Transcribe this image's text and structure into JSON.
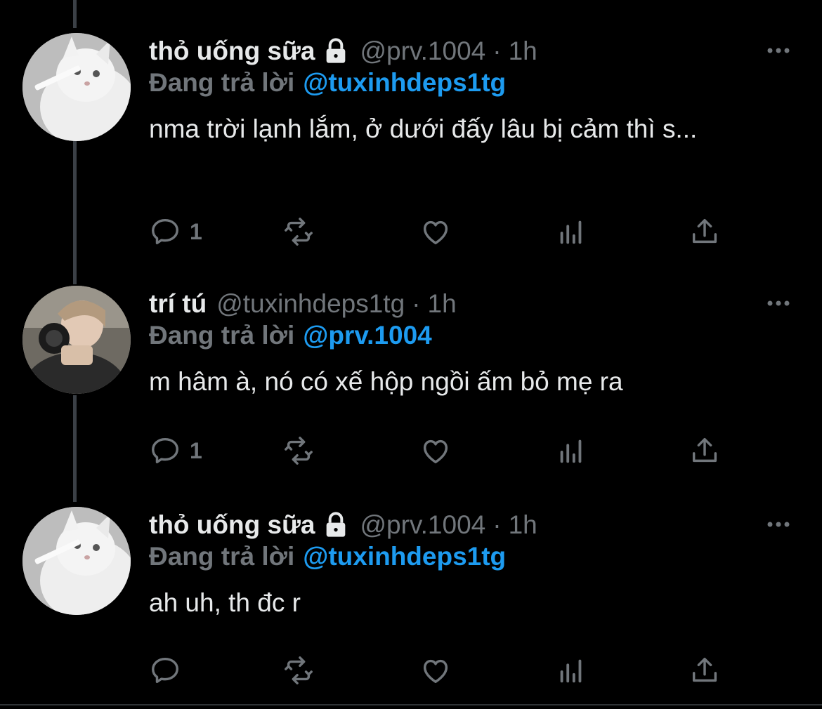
{
  "colors": {
    "background": "#000000",
    "text_primary": "#e7e9ea",
    "text_secondary": "#71767b",
    "accent": "#1d9bf0",
    "thread_line": "#3b4046"
  },
  "tweets": [
    {
      "display_name": "thỏ uống sữa",
      "protected": true,
      "lock_icon": "lock-icon",
      "handle": "@prv.1004",
      "separator": "·",
      "time": "1h",
      "reply_label": "Đang trả lời",
      "reply_to": "@tuxinhdeps1tg",
      "text": "nma trời lạnh lắm, ở dưới đấy lâu bị cảm thì s...",
      "reply_count": "1",
      "avatar": "white-cat-avatar"
    },
    {
      "display_name": "trí tú",
      "protected": false,
      "handle": "@tuxinhdeps1tg",
      "separator": "·",
      "time": "1h",
      "reply_label": "Đang trả lời",
      "reply_to": "@prv.1004",
      "text": "m hâm à, nó có xế hộp ngồi ấm bỏ mẹ ra",
      "reply_count": "1",
      "avatar": "person-with-camera-avatar"
    },
    {
      "display_name": "thỏ uống sữa",
      "protected": true,
      "lock_icon": "lock-icon",
      "handle": "@prv.1004",
      "separator": "·",
      "time": "1h",
      "reply_label": "Đang trả lời",
      "reply_to": "@tuxinhdeps1tg",
      "text": "ah uh, th đc r",
      "reply_count": "",
      "avatar": "white-cat-avatar"
    }
  ],
  "action_icons": [
    "reply-icon",
    "retweet-icon",
    "like-icon",
    "analytics-icon",
    "share-icon"
  ]
}
